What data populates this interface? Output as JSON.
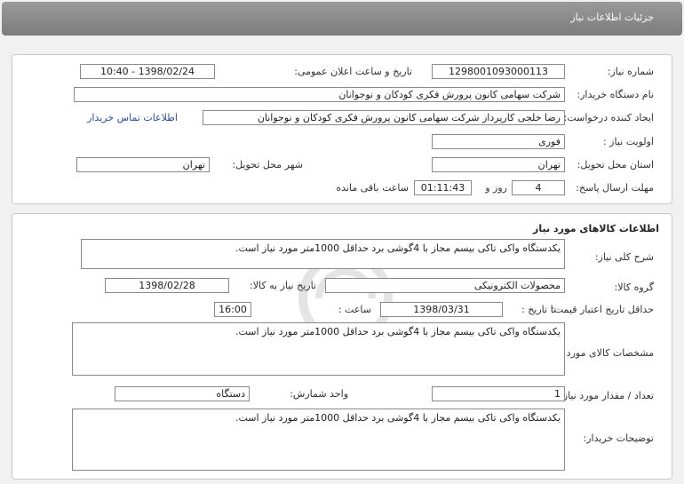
{
  "header": {
    "title": "جزئیات اطلاعات نیاز"
  },
  "need_info": {
    "need_number_label": "شماره نیاز:",
    "need_number": "1298001093000113",
    "announce_label": "تاریخ و ساعت اعلان عمومی:",
    "announce_value": "1398/02/24 - 10:40",
    "buyer_label": "نام دستگاه خریدار:",
    "buyer_value": "شرکت سهامی کانون پرورش فکری کودکان و نوجوانان",
    "creator_label": "ایجاد کننده درخواست:",
    "creator_value": "رضا خلجی کارپرداز شرکت سهامی کانون پرورش فکری کودکان و نوجوانان",
    "contact_link": "اطلاعات تماس خریدار",
    "priority_label": "اولویت نیاز :",
    "priority_value": "فوری",
    "province_label": "استان محل تحویل:",
    "province_value": "تهران",
    "city_label": "شهر محل تحویل:",
    "city_value": "تهران",
    "deadline_label": "مهلت ارسال پاسخ:",
    "days_value": "4",
    "days_label": "روز و",
    "time_value": "01:11:43",
    "remaining_label": "ساعت باقی مانده"
  },
  "goods": {
    "section_title": "اطلاعات کالاهای مورد نیاز",
    "summary_label": "شرح کلی نیاز:",
    "summary_value": "یکدستگاه واکی تاکی بیسم مجاز با 4گوشی برد حداقل 1000متر مورد نیاز است.",
    "group_label": "گروه کالا:",
    "group_value": "محصولات الکترونیکی",
    "need_date_label": "تاریخ نیاز به کالا:",
    "need_date_value": "1398/02/28",
    "validity_label": "حداقل تاریخ اعتبار قیمت:",
    "until_label": "تا تاریخ :",
    "until_value": "1398/03/31",
    "hour_label": "ساعت :",
    "hour_value": "16:00",
    "specs_label": "مشخصات کالای مورد نیاز:",
    "specs_value": "یکدستگاه واکی تاکی بیسم مجاز با 4گوشی برد حداقل 1000متر مورد نیاز است.",
    "qty_label": "تعداد / مقدار مورد نیاز:",
    "qty_value": "1",
    "unit_label": "واحد شمارش:",
    "unit_value": "دستگاه",
    "buyer_notes_label": "توضیحات خریدار:",
    "buyer_notes_value": "یکدستگاه واکی تاکی بیسم مجاز با 4گوشی برد حداقل 1000متر مورد نیاز است."
  },
  "colors": {
    "header_bg": "#8c8c8c",
    "link": "#2a4fa0",
    "field_border": "#8a8a8a"
  }
}
